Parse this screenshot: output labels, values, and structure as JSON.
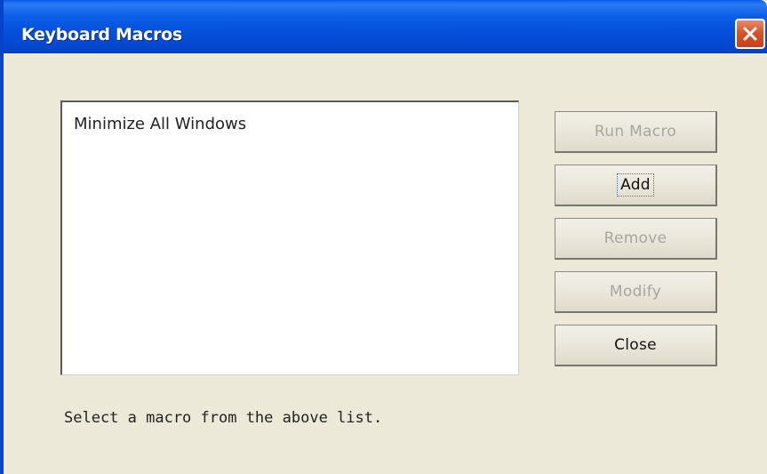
{
  "window": {
    "title": "Keyboard Macros",
    "close_icon": "close-icon"
  },
  "macro_list": {
    "items": [
      "Minimize All Windows"
    ]
  },
  "buttons": {
    "run_macro": {
      "label": "Run Macro",
      "enabled": false
    },
    "add": {
      "label": "Add",
      "enabled": true,
      "focused": true
    },
    "remove": {
      "label": "Remove",
      "enabled": false
    },
    "modify": {
      "label": "Modify",
      "enabled": false
    },
    "close": {
      "label": "Close",
      "enabled": true
    }
  },
  "status_text": "Select a macro from the above list.",
  "colors": {
    "titlebar": "#0550db",
    "dialog_background": "#ece9d8",
    "close_button": "#d9532a",
    "disabled_text": "#a7a6a0"
  }
}
